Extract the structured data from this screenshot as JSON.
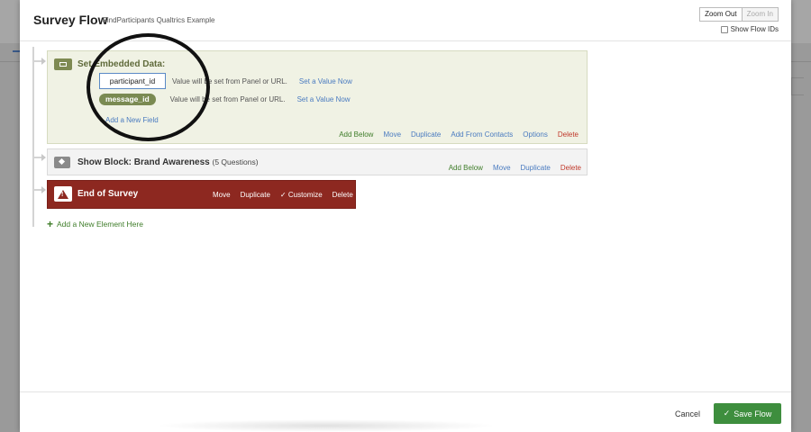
{
  "header": {
    "title": "Survey Flow",
    "subtitle": "FindParticipants Qualtrics Example",
    "zoom_out": "Zoom Out",
    "zoom_in": "Zoom In",
    "show_flow_ids": "Show Flow IDs"
  },
  "embedded_block": {
    "title": "Set Embedded Data:",
    "fields": [
      {
        "name": "participant_id",
        "note": "Value will be set from Panel or URL.",
        "link": "Set a Value Now"
      },
      {
        "name": "message_id",
        "note": "Value will be set from Panel or URL.",
        "link": "Set a Value Now"
      }
    ],
    "add_field": "Add a New Field",
    "actions": [
      "Add Below",
      "Move",
      "Duplicate",
      "Add From Contacts",
      "Options",
      "Delete"
    ]
  },
  "show_block": {
    "title": "Show Block: Brand Awareness",
    "count": "(5 Questions)",
    "actions": [
      "Add Below",
      "Move",
      "Duplicate",
      "Delete"
    ]
  },
  "end_block": {
    "title": "End of Survey",
    "actions": [
      "Move",
      "Duplicate",
      "✓ Customize",
      "Delete"
    ]
  },
  "add_element": "Add a New Element Here",
  "footer": {
    "cancel": "Cancel",
    "save": "Save Flow"
  },
  "colors": {
    "save_green": "#3e8e3e",
    "end_red": "#8d2820",
    "embed_olive": "#7a8a52",
    "link_blue": "#4a7bc0"
  }
}
